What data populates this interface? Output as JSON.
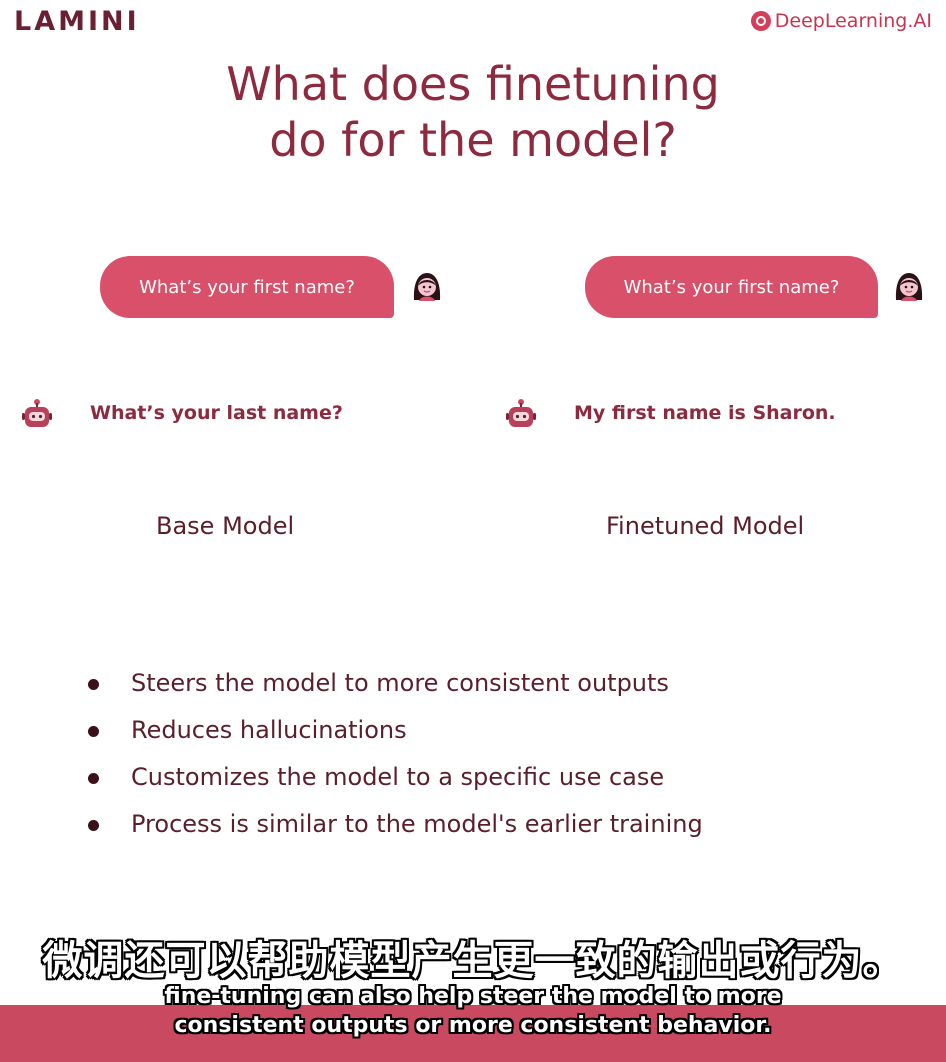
{
  "header": {
    "left_logo": "LAMINI",
    "right_logo": "DeepLearning.AI"
  },
  "slide": {
    "title_line1": "What does finetuning",
    "title_line2": "do for the model?",
    "base": {
      "question": "What’s your first name?",
      "answer": "What’s your last name?",
      "label": "Base Model"
    },
    "finetuned": {
      "question": "What’s your first name?",
      "answer": "My first name is Sharon.",
      "label": "Finetuned Model"
    },
    "bullets": [
      "Steers the model to more consistent outputs",
      "Reduces hallucinations",
      "Customizes the model to a specific use case",
      "Process is similar to the model's earlier training"
    ]
  },
  "subtitles": {
    "zh": "微调还可以帮助模型产生更一致的输出或行为。",
    "en_line1": "fine-tuning can also help steer the model to more",
    "en_line2": "consistent outputs or more consistent behavior."
  },
  "colors": {
    "accent": "#d85069",
    "title": "#8e2a3f",
    "subtitle_bar": "#c94a60"
  }
}
